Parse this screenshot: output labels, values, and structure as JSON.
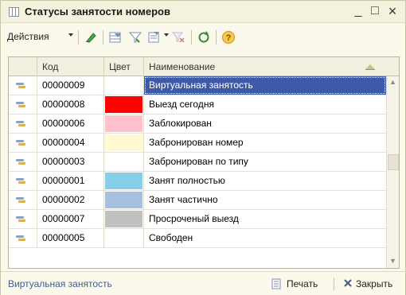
{
  "window": {
    "title": "Статусы занятости номеров",
    "minimize_glyph": "_",
    "maximize_glyph": "□",
    "close_glyph": "×"
  },
  "toolbar": {
    "actions_label": "Действия",
    "icons": [
      "edit-icon",
      "filter-icon",
      "filter-by-value-icon",
      "filter-list-icon",
      "clear-filter-icon",
      "refresh-icon",
      "help-icon"
    ]
  },
  "table": {
    "columns": [
      "Код",
      "Цвет",
      "Наименование"
    ],
    "rows": [
      {
        "code": "00000009",
        "color": "#ffffff",
        "name": "Виртуальная занятость",
        "selected": true
      },
      {
        "code": "00000008",
        "color": "#ff0000",
        "name": "Выезд сегодня",
        "selected": false
      },
      {
        "code": "00000006",
        "color": "#ffc0cb",
        "name": "Заблокирован",
        "selected": false
      },
      {
        "code": "00000004",
        "color": "#fff8d0",
        "name": "Забронирован номер",
        "selected": false
      },
      {
        "code": "00000003",
        "color": "#ffffff",
        "name": "Забронирован по типу",
        "selected": false
      },
      {
        "code": "00000001",
        "color": "#87cee8",
        "name": "Занят полностью",
        "selected": false
      },
      {
        "code": "00000002",
        "color": "#a8c0e0",
        "name": "Занят частично",
        "selected": false
      },
      {
        "code": "00000007",
        "color": "#c0c0c0",
        "name": "Просроченый выезд",
        "selected": false
      },
      {
        "code": "00000005",
        "color": "#ffffff",
        "name": "Свободен",
        "selected": false
      }
    ]
  },
  "footer": {
    "status_text": "Виртуальная занятость",
    "print_label": "Печать",
    "close_label": "Закрыть"
  },
  "colors": {
    "selection": "#3d5aa8",
    "link": "#3b5da0",
    "window_bg": "#fbf9ec"
  }
}
